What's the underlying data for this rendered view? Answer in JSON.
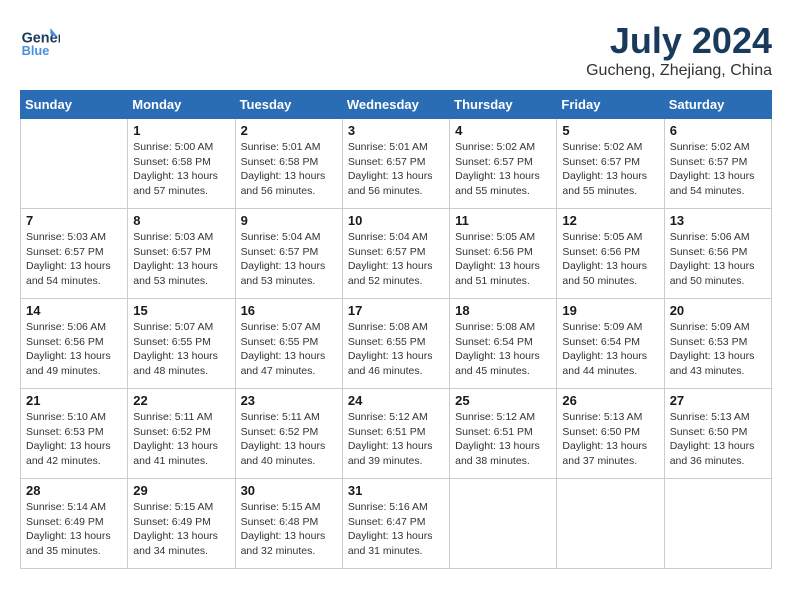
{
  "header": {
    "logo_line1": "General",
    "logo_line2": "Blue",
    "month_title": "July 2024",
    "location": "Gucheng, Zhejiang, China"
  },
  "weekdays": [
    "Sunday",
    "Monday",
    "Tuesday",
    "Wednesday",
    "Thursday",
    "Friday",
    "Saturday"
  ],
  "weeks": [
    [
      {
        "day": "",
        "info": ""
      },
      {
        "day": "1",
        "info": "Sunrise: 5:00 AM\nSunset: 6:58 PM\nDaylight: 13 hours\nand 57 minutes."
      },
      {
        "day": "2",
        "info": "Sunrise: 5:01 AM\nSunset: 6:58 PM\nDaylight: 13 hours\nand 56 minutes."
      },
      {
        "day": "3",
        "info": "Sunrise: 5:01 AM\nSunset: 6:57 PM\nDaylight: 13 hours\nand 56 minutes."
      },
      {
        "day": "4",
        "info": "Sunrise: 5:02 AM\nSunset: 6:57 PM\nDaylight: 13 hours\nand 55 minutes."
      },
      {
        "day": "5",
        "info": "Sunrise: 5:02 AM\nSunset: 6:57 PM\nDaylight: 13 hours\nand 55 minutes."
      },
      {
        "day": "6",
        "info": "Sunrise: 5:02 AM\nSunset: 6:57 PM\nDaylight: 13 hours\nand 54 minutes."
      }
    ],
    [
      {
        "day": "7",
        "info": "Sunrise: 5:03 AM\nSunset: 6:57 PM\nDaylight: 13 hours\nand 54 minutes."
      },
      {
        "day": "8",
        "info": "Sunrise: 5:03 AM\nSunset: 6:57 PM\nDaylight: 13 hours\nand 53 minutes."
      },
      {
        "day": "9",
        "info": "Sunrise: 5:04 AM\nSunset: 6:57 PM\nDaylight: 13 hours\nand 53 minutes."
      },
      {
        "day": "10",
        "info": "Sunrise: 5:04 AM\nSunset: 6:57 PM\nDaylight: 13 hours\nand 52 minutes."
      },
      {
        "day": "11",
        "info": "Sunrise: 5:05 AM\nSunset: 6:56 PM\nDaylight: 13 hours\nand 51 minutes."
      },
      {
        "day": "12",
        "info": "Sunrise: 5:05 AM\nSunset: 6:56 PM\nDaylight: 13 hours\nand 50 minutes."
      },
      {
        "day": "13",
        "info": "Sunrise: 5:06 AM\nSunset: 6:56 PM\nDaylight: 13 hours\nand 50 minutes."
      }
    ],
    [
      {
        "day": "14",
        "info": "Sunrise: 5:06 AM\nSunset: 6:56 PM\nDaylight: 13 hours\nand 49 minutes."
      },
      {
        "day": "15",
        "info": "Sunrise: 5:07 AM\nSunset: 6:55 PM\nDaylight: 13 hours\nand 48 minutes."
      },
      {
        "day": "16",
        "info": "Sunrise: 5:07 AM\nSunset: 6:55 PM\nDaylight: 13 hours\nand 47 minutes."
      },
      {
        "day": "17",
        "info": "Sunrise: 5:08 AM\nSunset: 6:55 PM\nDaylight: 13 hours\nand 46 minutes."
      },
      {
        "day": "18",
        "info": "Sunrise: 5:08 AM\nSunset: 6:54 PM\nDaylight: 13 hours\nand 45 minutes."
      },
      {
        "day": "19",
        "info": "Sunrise: 5:09 AM\nSunset: 6:54 PM\nDaylight: 13 hours\nand 44 minutes."
      },
      {
        "day": "20",
        "info": "Sunrise: 5:09 AM\nSunset: 6:53 PM\nDaylight: 13 hours\nand 43 minutes."
      }
    ],
    [
      {
        "day": "21",
        "info": "Sunrise: 5:10 AM\nSunset: 6:53 PM\nDaylight: 13 hours\nand 42 minutes."
      },
      {
        "day": "22",
        "info": "Sunrise: 5:11 AM\nSunset: 6:52 PM\nDaylight: 13 hours\nand 41 minutes."
      },
      {
        "day": "23",
        "info": "Sunrise: 5:11 AM\nSunset: 6:52 PM\nDaylight: 13 hours\nand 40 minutes."
      },
      {
        "day": "24",
        "info": "Sunrise: 5:12 AM\nSunset: 6:51 PM\nDaylight: 13 hours\nand 39 minutes."
      },
      {
        "day": "25",
        "info": "Sunrise: 5:12 AM\nSunset: 6:51 PM\nDaylight: 13 hours\nand 38 minutes."
      },
      {
        "day": "26",
        "info": "Sunrise: 5:13 AM\nSunset: 6:50 PM\nDaylight: 13 hours\nand 37 minutes."
      },
      {
        "day": "27",
        "info": "Sunrise: 5:13 AM\nSunset: 6:50 PM\nDaylight: 13 hours\nand 36 minutes."
      }
    ],
    [
      {
        "day": "28",
        "info": "Sunrise: 5:14 AM\nSunset: 6:49 PM\nDaylight: 13 hours\nand 35 minutes."
      },
      {
        "day": "29",
        "info": "Sunrise: 5:15 AM\nSunset: 6:49 PM\nDaylight: 13 hours\nand 34 minutes."
      },
      {
        "day": "30",
        "info": "Sunrise: 5:15 AM\nSunset: 6:48 PM\nDaylight: 13 hours\nand 32 minutes."
      },
      {
        "day": "31",
        "info": "Sunrise: 5:16 AM\nSunset: 6:47 PM\nDaylight: 13 hours\nand 31 minutes."
      },
      {
        "day": "",
        "info": ""
      },
      {
        "day": "",
        "info": ""
      },
      {
        "day": "",
        "info": ""
      }
    ]
  ]
}
